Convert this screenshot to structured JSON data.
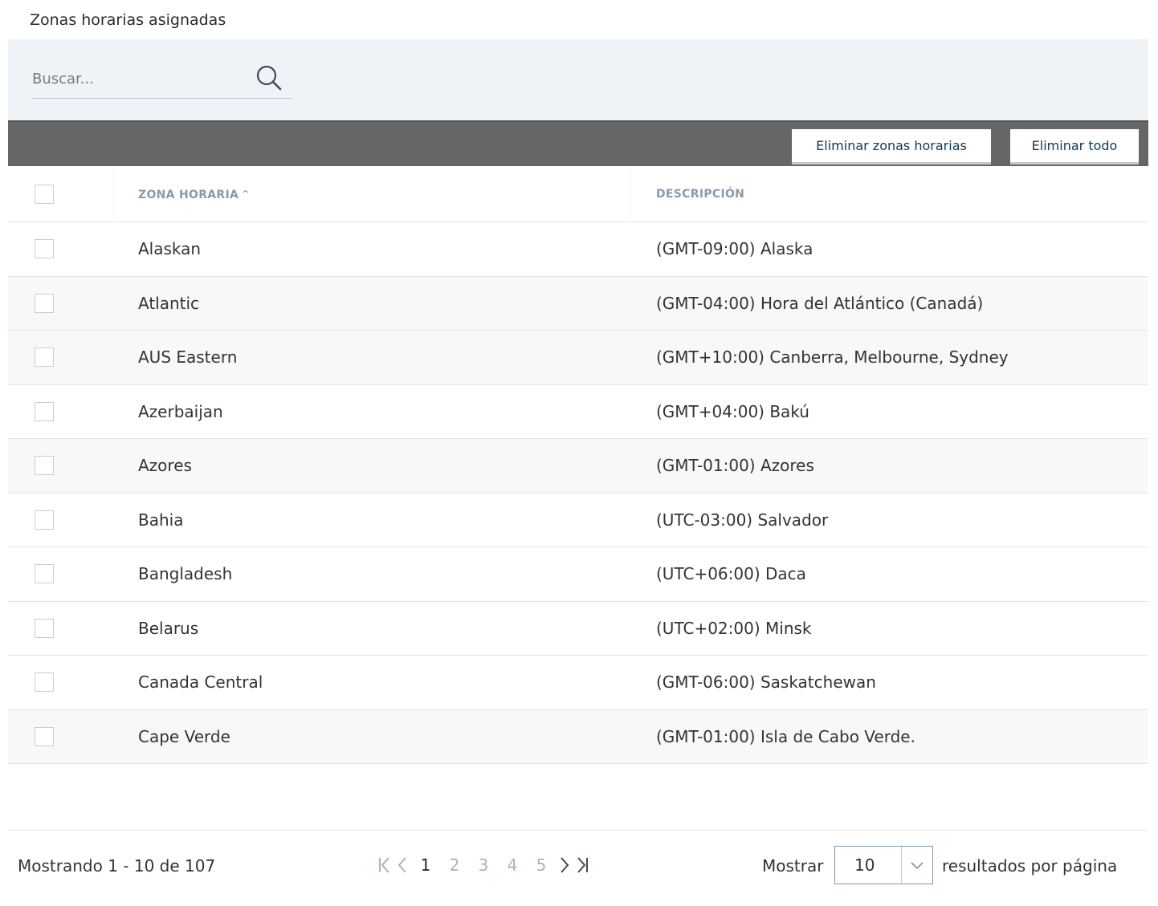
{
  "title": "Zonas horarias asignadas",
  "search": {
    "placeholder": "Buscar..."
  },
  "toolbar": {
    "remove_tz_label": "Eliminar zonas horarias",
    "remove_all_label": "Eliminar todo"
  },
  "table": {
    "columns": {
      "name": "ZONA HORARIA",
      "description": "DESCRIPCIÓN"
    },
    "rows": [
      {
        "name": "Alaskan",
        "description": "(GMT-09:00) Alaska"
      },
      {
        "name": "Atlantic",
        "description": "(GMT-04:00) Hora del Atlántico (Canadá)"
      },
      {
        "name": "AUS Eastern",
        "description": "(GMT+10:00) Canberra, Melbourne, Sydney"
      },
      {
        "name": "Azerbaijan",
        "description": "(GMT+04:00) Bakú"
      },
      {
        "name": "Azores",
        "description": "(GMT-01:00) Azores"
      },
      {
        "name": "Bahia",
        "description": "(UTC-03:00) Salvador"
      },
      {
        "name": "Bangladesh",
        "description": "(UTC+06:00) Daca"
      },
      {
        "name": "Belarus",
        "description": "(UTC+02:00) Minsk"
      },
      {
        "name": "Canada Central",
        "description": "(GMT-06:00) Saskatchewan"
      },
      {
        "name": "Cape Verde",
        "description": "(GMT-01:00) Isla de Cabo Verde."
      }
    ]
  },
  "footer": {
    "showing": "Mostrando 1 - 10 de 107",
    "pages": [
      "1",
      "2",
      "3",
      "4",
      "5"
    ],
    "current_page": "1",
    "show_label": "Mostrar",
    "page_size": "10",
    "per_page_label": "resultados por página"
  },
  "colors": {
    "toolbar_bg": "#666666",
    "search_bg": "#eef3f7",
    "button_text": "#0b3a5c",
    "muted_header": "#8a9aa8",
    "inactive_page": "#a6b2bd"
  },
  "icons": {
    "search": "search-icon",
    "sort": "sort-ascending-icon",
    "first": "first-page-icon",
    "prev": "previous-page-icon",
    "next": "next-page-icon",
    "last": "last-page-icon",
    "dropdown": "chevron-down-icon"
  }
}
